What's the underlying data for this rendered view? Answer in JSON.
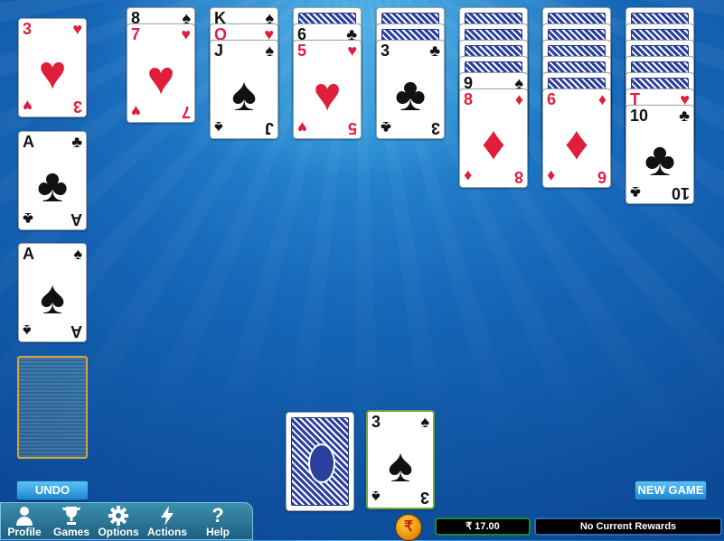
{
  "foundations": [
    {
      "rank": "3",
      "suit": "♥",
      "color": "red"
    },
    {
      "rank": "A",
      "suit": "♣",
      "color": "black"
    },
    {
      "rank": "A",
      "suit": "♠",
      "color": "black"
    },
    {
      "empty": true
    }
  ],
  "tableau": [
    {
      "hidden": 0,
      "peek": [
        {
          "rank": "8",
          "suit": "♠",
          "color": "black"
        }
      ],
      "top": {
        "rank": "7",
        "suit": "♥",
        "color": "red"
      }
    },
    {
      "hidden": 0,
      "peek": [
        {
          "rank": "K",
          "suit": "♠",
          "color": "black"
        },
        {
          "rank": "Q",
          "suit": "♥",
          "color": "red"
        }
      ],
      "top": {
        "rank": "J",
        "suit": "♠",
        "color": "black"
      }
    },
    {
      "hidden": 1,
      "peek": [
        {
          "rank": "6",
          "suit": "♣",
          "color": "black"
        }
      ],
      "top": {
        "rank": "5",
        "suit": "♥",
        "color": "red"
      }
    },
    {
      "hidden": 2,
      "peek": [],
      "top": {
        "rank": "3",
        "suit": "♣",
        "color": "black"
      }
    },
    {
      "hidden": 4,
      "peek": [
        {
          "rank": "9",
          "suit": "♠",
          "color": "black"
        }
      ],
      "top": {
        "rank": "8",
        "suit": "♦",
        "color": "red"
      }
    },
    {
      "hidden": 5,
      "peek": [],
      "top": {
        "rank": "6",
        "suit": "♦",
        "color": "red"
      }
    },
    {
      "hidden": 5,
      "peek": [
        {
          "rank": "T",
          "suit": "♥",
          "color": "red"
        }
      ],
      "top": {
        "rank": "10",
        "suit": "♣",
        "color": "black"
      }
    }
  ],
  "stock": {
    "face_down": true
  },
  "waste": {
    "rank": "3",
    "suit": "♠",
    "color": "black"
  },
  "buttons": {
    "undo": "UNDO",
    "new_game": "NEW GAME"
  },
  "menu": [
    {
      "label": "Profile",
      "icon": "profile-icon"
    },
    {
      "label": "Games",
      "icon": "trophy-icon"
    },
    {
      "label": "Options",
      "icon": "gear-icon"
    },
    {
      "label": "Actions",
      "icon": "lightning-icon"
    },
    {
      "label": "Help",
      "icon": "help-icon"
    }
  ],
  "currency": {
    "symbol": "₹",
    "balance": "₹ 17.00"
  },
  "rewards": "No Current Rewards",
  "colors": {
    "red_suit": "#e01e3c",
    "black_suit": "#111111",
    "accent": "#1b86d2"
  }
}
